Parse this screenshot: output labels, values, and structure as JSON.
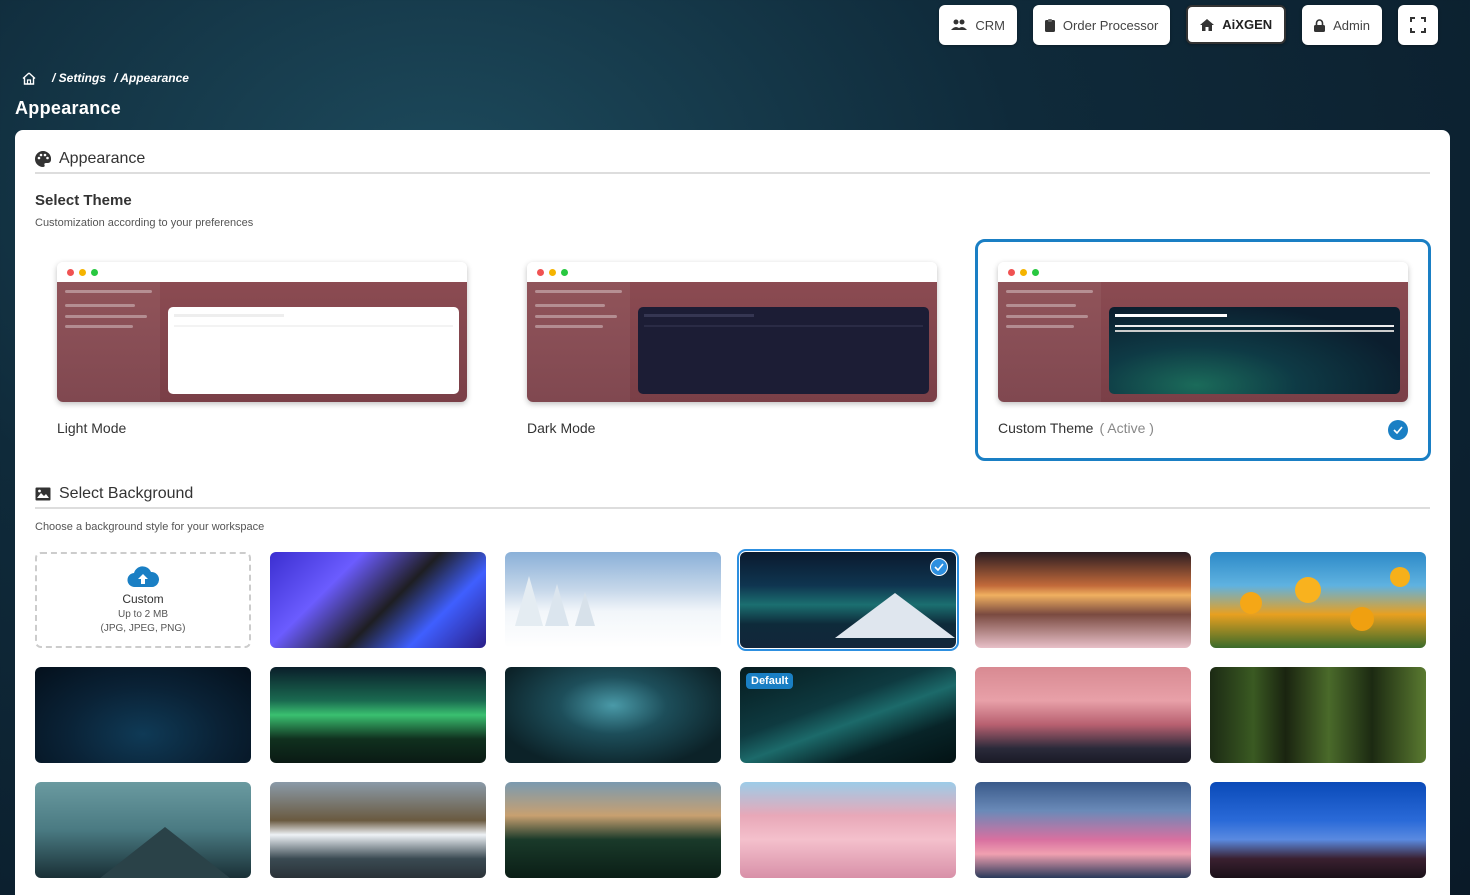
{
  "topbar": {
    "crm": "CRM",
    "order_processor": "Order Processor",
    "aixgen": "AiXGEN",
    "admin": "Admin"
  },
  "breadcrumb": {
    "settings": "/ Settings",
    "appearance": "/ Appearance"
  },
  "page_title": "Appearance",
  "appearance_section": {
    "title": "Appearance",
    "select_theme": "Select Theme",
    "select_theme_desc": "Customization according to your preferences",
    "themes": [
      {
        "label": "Light Mode",
        "active_text": "",
        "selected": false
      },
      {
        "label": "Dark Mode",
        "active_text": "",
        "selected": false
      },
      {
        "label": "Custom Theme",
        "active_text": "( Active )",
        "selected": true
      }
    ]
  },
  "background_section": {
    "title": "Select Background",
    "desc": "Choose a background style for your workspace",
    "upload": {
      "title": "Custom",
      "size": "Up to 2 MB",
      "formats": "(JPG, JPEG, PNG)"
    },
    "default_badge": "Default",
    "selected_index": 3
  },
  "colors": {
    "accent": "#1a7fc4",
    "preview_sidebar": "#8b4b52"
  }
}
